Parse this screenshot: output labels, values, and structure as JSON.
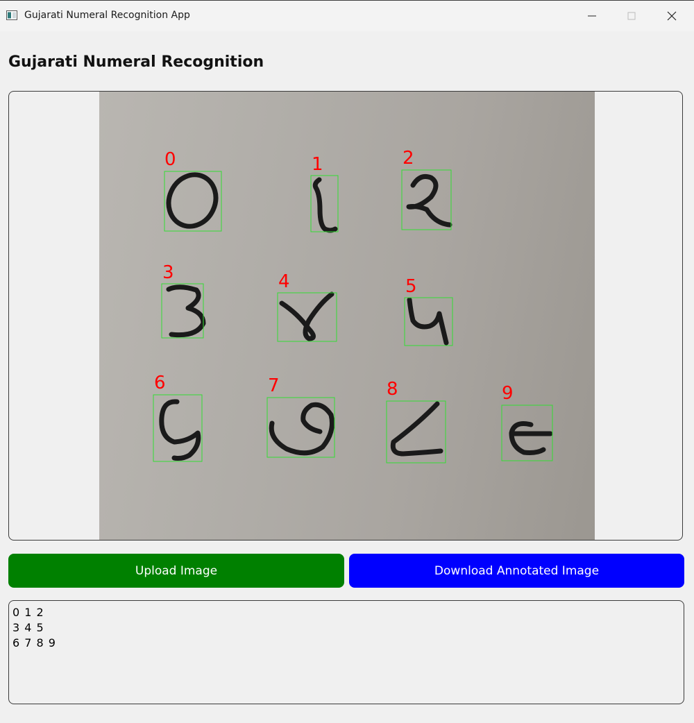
{
  "window": {
    "title": "Gujarati Numeral Recognition App",
    "icon": "app-window-icon",
    "controls": [
      "minimize-icon",
      "maximize-icon",
      "close-icon"
    ]
  },
  "main": {
    "heading": "Gujarati Numeral Recognition"
  },
  "image_panel": {
    "detections": [
      {
        "label": "0",
        "glyph": "૦"
      },
      {
        "label": "1",
        "glyph": "૧"
      },
      {
        "label": "2",
        "glyph": "૨"
      },
      {
        "label": "3",
        "glyph": "૩"
      },
      {
        "label": "4",
        "glyph": "૪"
      },
      {
        "label": "5",
        "glyph": "૫"
      },
      {
        "label": "6",
        "glyph": "૬"
      },
      {
        "label": "7",
        "glyph": "૭"
      },
      {
        "label": "8",
        "glyph": "૮"
      },
      {
        "label": "9",
        "glyph": "૯"
      }
    ],
    "label_color": "#ff0000",
    "box_color": "#00ff00"
  },
  "buttons": {
    "upload_label": "Upload Image",
    "download_label": "Download Annotated Image",
    "upload_color": "#008000",
    "download_color": "#0000ff"
  },
  "result": {
    "lines": [
      "0 1 2",
      "3 4 5",
      "6 7 8 9"
    ]
  }
}
